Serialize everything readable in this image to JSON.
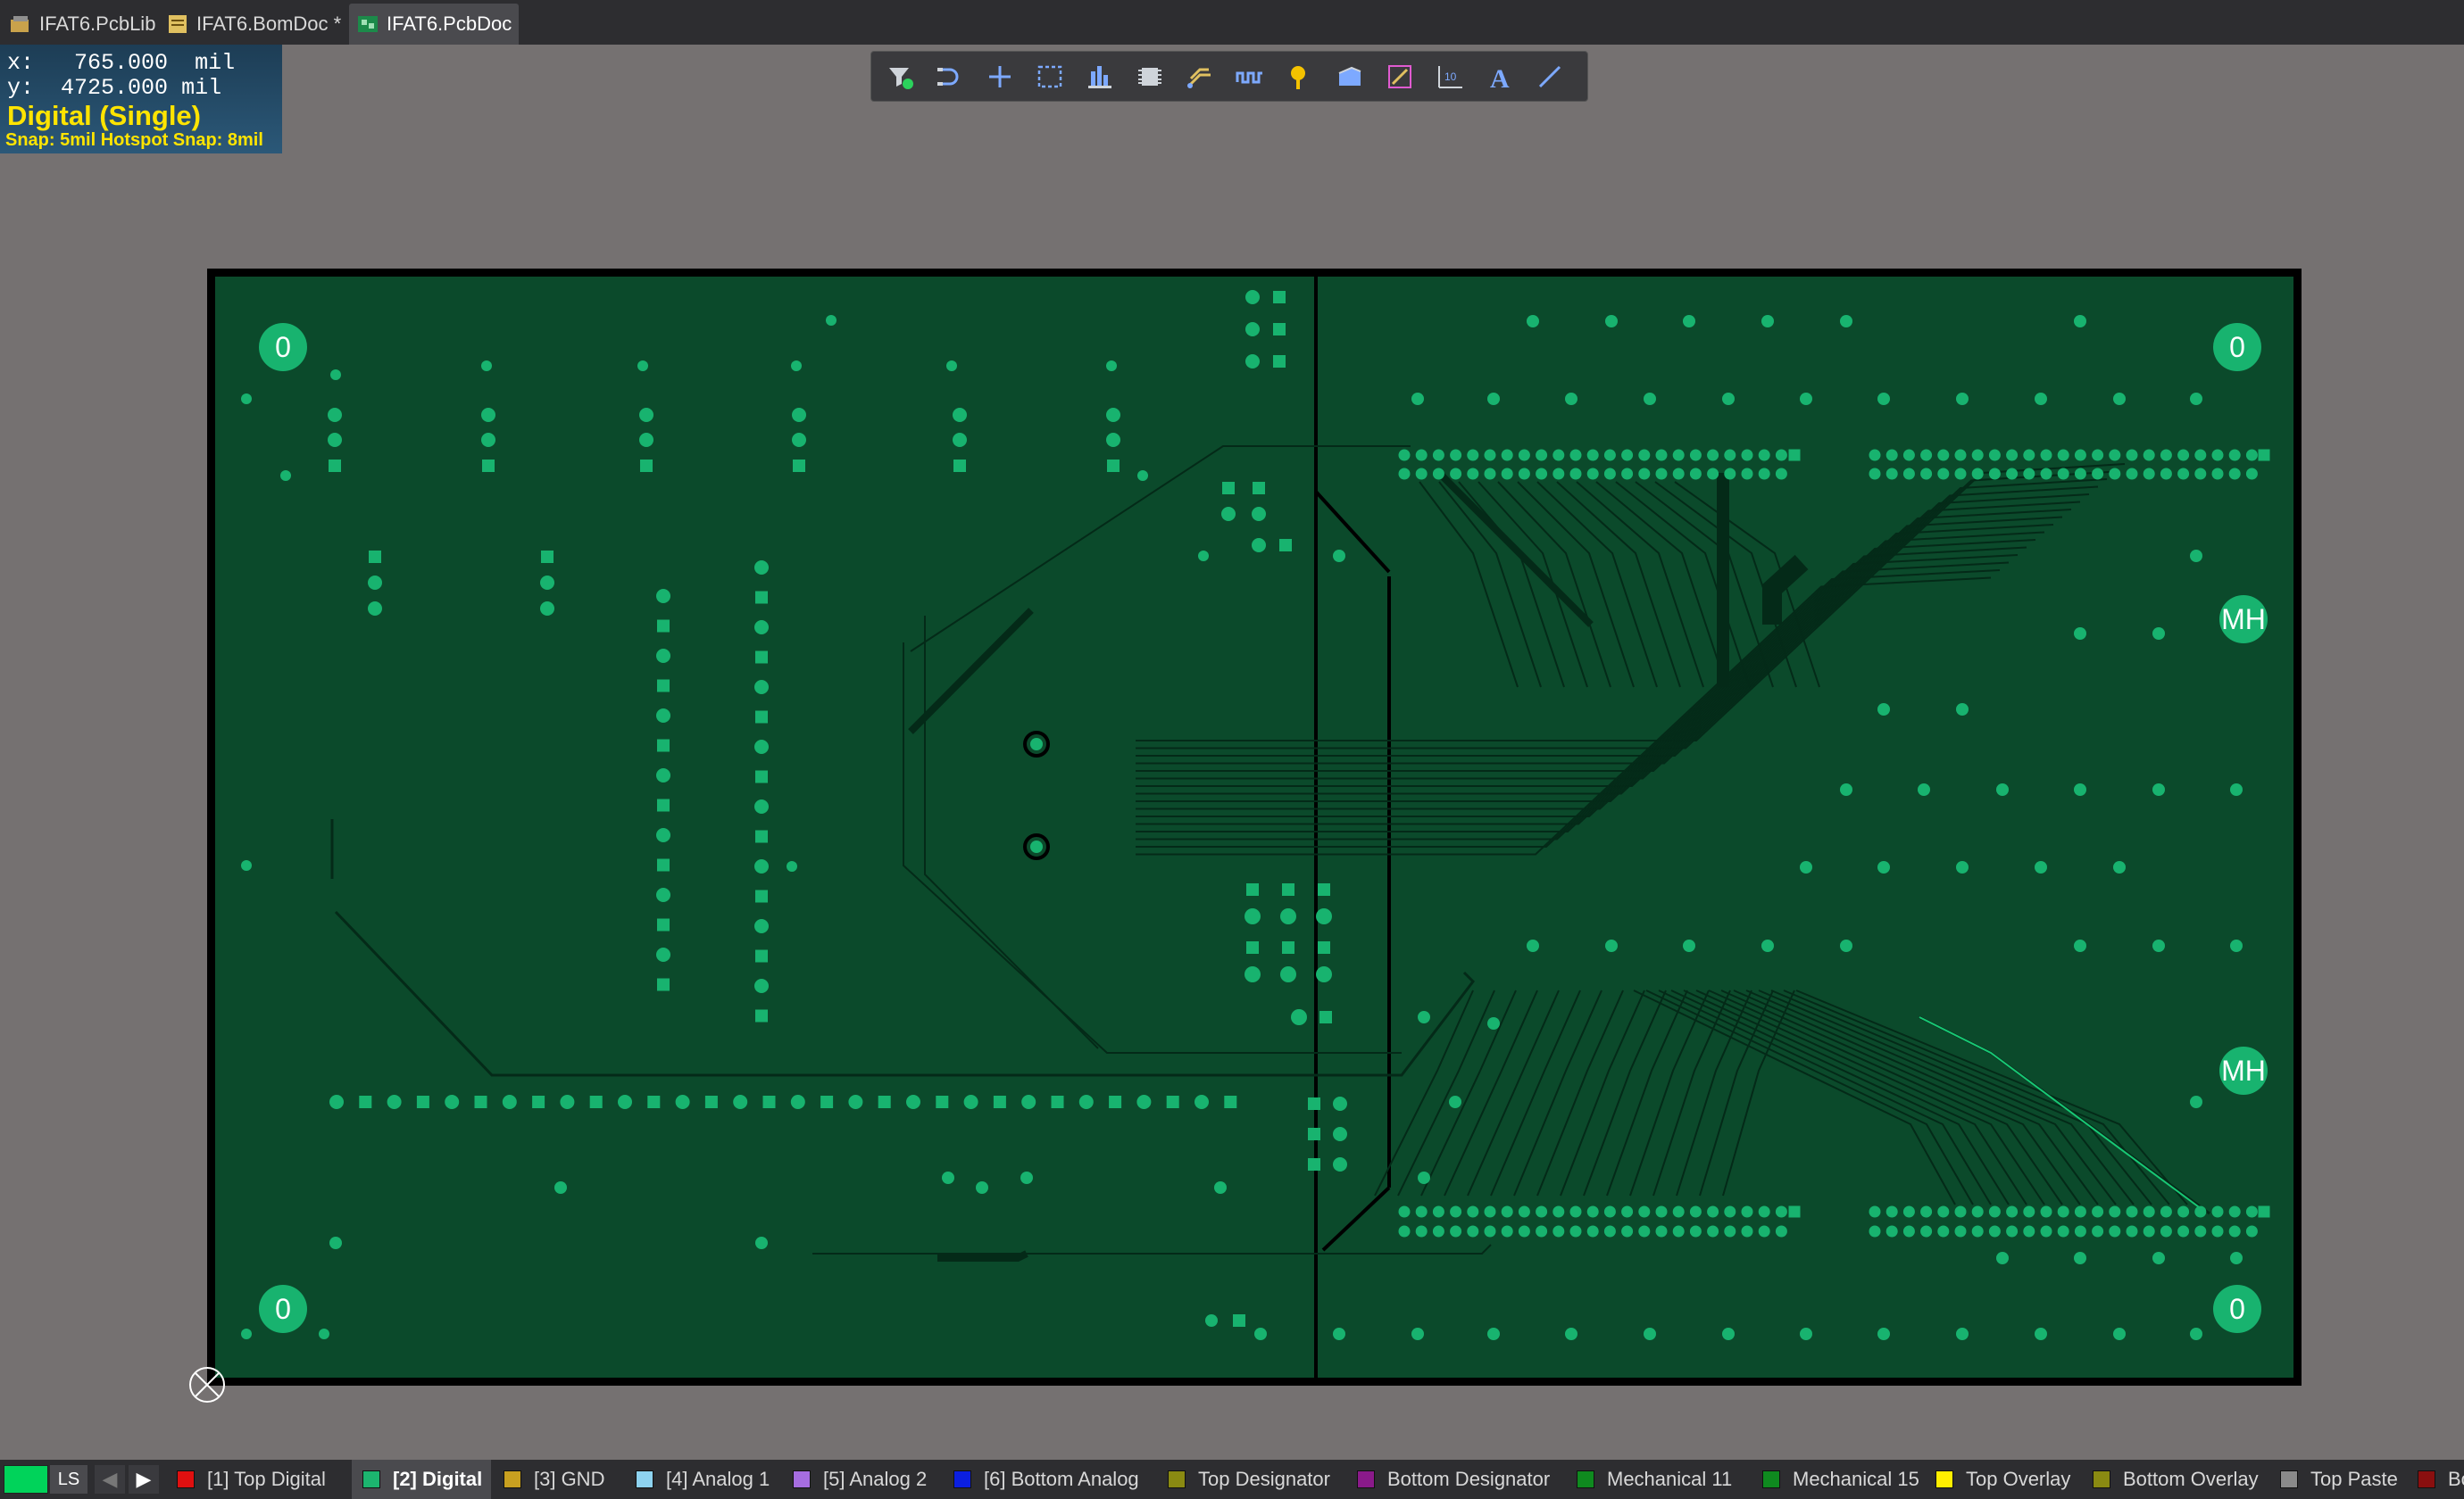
{
  "tabs": [
    {
      "label": "IFAT6.PcbLib",
      "active": false
    },
    {
      "label": "IFAT6.BomDoc *",
      "active": false
    },
    {
      "label": "IFAT6.PcbDoc",
      "active": true
    }
  ],
  "hud": {
    "x_label": "x:",
    "x_value": "765.000",
    "x_unit": "mil",
    "y_label": "y:",
    "y_value": "4725.000",
    "y_unit": "mil",
    "mode": "Digital (Single)",
    "snap": "Snap: 5mil Hotspot Snap: 8mil"
  },
  "toolbar": [
    "filter-icon",
    "interactive-route-icon",
    "cross-select-icon",
    "select-rect-icon",
    "align-chart-icon",
    "component-icon",
    "route-multiple-icon",
    "length-tune-icon",
    "probe-icon",
    "polygon-pour-icon",
    "dimension-icon",
    "bar-chart-icon",
    "text-icon",
    "line-icon"
  ],
  "board": {
    "hole_label": "0",
    "mount_label": "MH",
    "colors": {
      "board": "#0b4a2b",
      "pad": "#18b36f",
      "trace": "#042a18",
      "edge": "#000000"
    }
  },
  "layer_bar": {
    "indicator_color": "#00d35a",
    "ls_label": "LS",
    "layers": [
      {
        "label": "[1] Top Digital",
        "color": "#e01010",
        "active": false
      },
      {
        "label": "[2] Digital",
        "color": "#1cb56f",
        "active": true
      },
      {
        "label": "[3] GND",
        "color": "#c8a020",
        "active": false
      },
      {
        "label": "[4] Analog 1",
        "color": "#8ed3f0",
        "active": false
      },
      {
        "label": "[5] Analog 2",
        "color": "#a66de0",
        "active": false
      },
      {
        "label": "[6] Bottom Analog",
        "color": "#0b1fe0",
        "active": false
      },
      {
        "label": "Top Designator",
        "color": "#8a8a12",
        "active": false
      },
      {
        "label": "Bottom Designator",
        "color": "#8a1a8a",
        "active": false
      },
      {
        "label": "Mechanical 11",
        "color": "#0f8a1f",
        "active": false
      },
      {
        "label": "Mechanical 15",
        "color": "#0f8a1f",
        "active": false
      },
      {
        "label": "Top Overlay",
        "color": "#ffee00",
        "active": false
      },
      {
        "label": "Bottom Overlay",
        "color": "#8a8a12",
        "active": false
      },
      {
        "label": "Top Paste",
        "color": "#8a8a8a",
        "active": false
      },
      {
        "label": "Bo",
        "color": "#8a0f0f",
        "active": false
      }
    ]
  }
}
